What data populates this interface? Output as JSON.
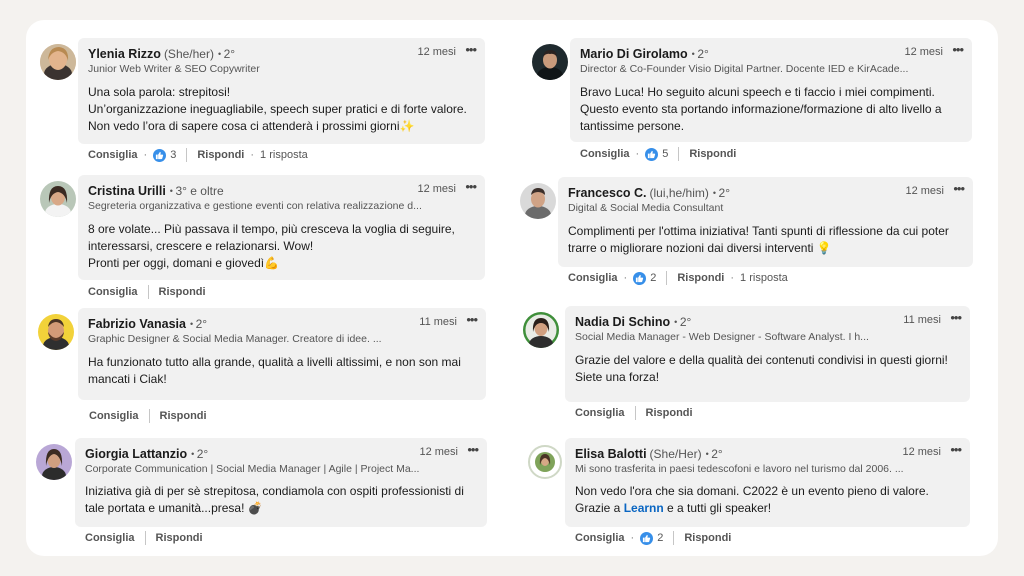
{
  "comments": [
    {
      "name": "Ylenia Rizzo",
      "pronouns": "(She/her)",
      "degree": "2°",
      "time": "12 mesi",
      "headline": "Junior Web Writer & SEO Copywriter",
      "text": "Una sola parola: strepitosi!\nUn’organizzazione ineguagliabile, speech super pratici e di forte valore. Non vedo l’ora di sapere cosa ci attenderà i prossimi giorni✨",
      "like_label": "Consiglia",
      "likes": "3",
      "reply_label": "Rispondi",
      "replies": "1 risposta"
    },
    {
      "name": "Mario Di Girolamo",
      "degree": "2°",
      "time": "12 mesi",
      "headline": "Director & Co-Founder Visio Digital Partner. Docente IED e KirAcade...",
      "text": "Bravo Luca! Ho seguito alcuni speech e ti faccio i miei compimenti. Questo evento sta portando informazione/formazione di alto livello a tantissime persone.",
      "like_label": "Consiglia",
      "likes": "5",
      "reply_label": "Rispondi"
    },
    {
      "name": "Cristina Urilli",
      "degree": "3° e oltre",
      "time": "12 mesi",
      "headline": "Segreteria organizzativa e gestione eventi con relativa realizzazione d...",
      "text": "8 ore volate... Più passava il tempo, più cresceva la voglia di seguire, interessarsi, crescere e relazionarsi. Wow!\nPronti per oggi, domani e giovedì💪",
      "like_label": "Consiglia",
      "reply_label": "Rispondi"
    },
    {
      "name": "Francesco C.",
      "pronouns": "(lui,he/him)",
      "degree": "2°",
      "time": "12 mesi",
      "headline": "Digital & Social Media Consultant",
      "text": "Complimenti per l'ottima iniziativa! Tanti spunti di riflessione da cui poter trarre o migliorare nozioni dai diversi interventi 💡",
      "like_label": "Consiglia",
      "likes": "2",
      "reply_label": "Rispondi",
      "replies": "1 risposta"
    },
    {
      "name": "Fabrizio Vanasia",
      "degree": "2°",
      "time": "11 mesi",
      "headline": "Graphic Designer & Social Media Manager. Creatore di idee. ...",
      "text": "Ha funzionato tutto alla grande, qualità a livelli altissimi, e non son mai mancati i Ciak!",
      "like_label": "Consiglia",
      "reply_label": "Rispondi"
    },
    {
      "name": "Nadia Di Schino",
      "degree": "2°",
      "time": "11 mesi",
      "headline": "Social Media Manager - Web Designer - Software Analyst. I h...",
      "text": "Grazie del valore e della qualità dei contenuti condivisi in questi giorni! Siete una forza!",
      "like_label": "Consiglia",
      "reply_label": "Rispondi"
    },
    {
      "name": "Giorgia Lattanzio",
      "degree": "2°",
      "time": "12 mesi",
      "headline": "Corporate Communication | Social Media Manager | Agile | Project Ma...",
      "text": "Iniziativa già di per sè strepitosa, condiamola con ospiti professionisti di tale portata e umanità...presa! 💣",
      "like_label": "Consiglia",
      "reply_label": "Rispondi"
    },
    {
      "name": "Elisa Balotti",
      "pronouns": "(She/Her)",
      "degree": "2°",
      "time": "12 mesi",
      "headline": "Mi sono trasferita in paesi tedescofoni e lavoro nel turismo dal 2006. ...",
      "text_before": "Non vedo l'ora che sia domani. C2022 è un evento pieno di valore. Grazie a ",
      "text_link": "Learnn",
      "text_after": " e a tutti gli speaker!",
      "like_label": "Consiglia",
      "likes": "2",
      "reply_label": "Rispondi"
    }
  ],
  "colors": {
    "page_bg": "#f4f2ef",
    "bubble_bg": "#f1f1f1",
    "like_blue": "#378fe9",
    "link_blue": "#0a66c2"
  }
}
